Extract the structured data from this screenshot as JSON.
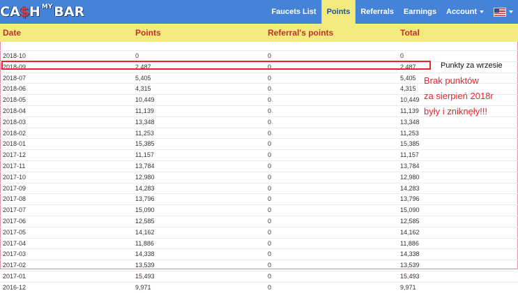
{
  "logo": {
    "left": "CA",
    "dollar": "$",
    "h": "H",
    "mid": "MY",
    "right": "BAR"
  },
  "nav": {
    "items": [
      {
        "label": "Faucets List"
      },
      {
        "label": "Points"
      },
      {
        "label": "Referrals"
      },
      {
        "label": "Earnings"
      },
      {
        "label": "Account"
      }
    ],
    "language_icon": "us-flag-icon"
  },
  "table": {
    "headers": {
      "date": "Date",
      "points": "Points",
      "referral": "Referral's points",
      "total": "Total"
    },
    "rows": [
      {
        "date": "2018-10",
        "points": "0",
        "referral": "0",
        "total": "0"
      },
      {
        "date": "2018-09",
        "points": "2,487",
        "referral": "0",
        "total": "2,487"
      },
      {
        "date": "2018-07",
        "points": "5,405",
        "referral": "0",
        "total": "5,405"
      },
      {
        "date": "2018-06",
        "points": "4,315",
        "referral": "0",
        "total": "4,315"
      },
      {
        "date": "2018-05",
        "points": "10,449",
        "referral": "0",
        "total": "10,449"
      },
      {
        "date": "2018-04",
        "points": "11,139",
        "referral": "0",
        "total": "11,139"
      },
      {
        "date": "2018-03",
        "points": "13,348",
        "referral": "0",
        "total": "13,348"
      },
      {
        "date": "2018-02",
        "points": "11,253",
        "referral": "0",
        "total": "11,253"
      },
      {
        "date": "2018-01",
        "points": "15,385",
        "referral": "0",
        "total": "15,385"
      },
      {
        "date": "2017-12",
        "points": "11,157",
        "referral": "0",
        "total": "11,157"
      },
      {
        "date": "2017-11",
        "points": "13,784",
        "referral": "0",
        "total": "13,784"
      },
      {
        "date": "2017-10",
        "points": "12,980",
        "referral": "0",
        "total": "12,980"
      },
      {
        "date": "2017-09",
        "points": "14,283",
        "referral": "0",
        "total": "14,283"
      },
      {
        "date": "2017-08",
        "points": "13,796",
        "referral": "0",
        "total": "13,796"
      },
      {
        "date": "2017-07",
        "points": "15,090",
        "referral": "0",
        "total": "15,090"
      },
      {
        "date": "2017-06",
        "points": "12,585",
        "referral": "0",
        "total": "12,585"
      },
      {
        "date": "2017-05",
        "points": "14,162",
        "referral": "0",
        "total": "14,162"
      },
      {
        "date": "2017-04",
        "points": "11,886",
        "referral": "0",
        "total": "11,886"
      },
      {
        "date": "2017-03",
        "points": "14,338",
        "referral": "0",
        "total": "14,338"
      },
      {
        "date": "2017-02",
        "points": "13,539",
        "referral": "0",
        "total": "13,539"
      },
      {
        "date": "2017-01",
        "points": "15,493",
        "referral": "0",
        "total": "15,493"
      },
      {
        "date": "2016-12",
        "points": "9,971",
        "referral": "0",
        "total": "9,971"
      }
    ]
  },
  "annotations": {
    "note_black": "Punkty za wrzesie",
    "note_red_lines": [
      "Brak punktów",
      "za sierpień 2018r",
      "były i zniknęły!!!"
    ]
  },
  "colors": {
    "nav_bg": "#4583d8",
    "header_bg": "#f3eb7d",
    "header_text": "#c6302a",
    "annotation_red": "#e8232c"
  }
}
